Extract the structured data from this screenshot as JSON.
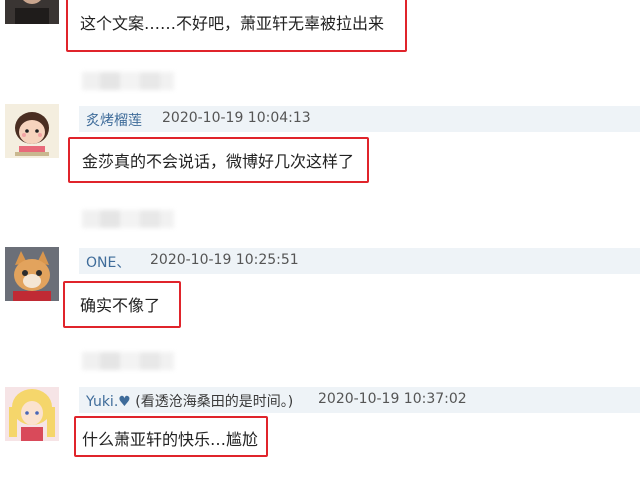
{
  "comments": [
    {
      "avatar": "user-avatar",
      "text": "这个文案……不好吧，萧亚轩无辜被拉出来"
    },
    {
      "avatar": "cartoon-girl-avatar",
      "username": "炙烤榴莲",
      "timestamp": "2020-10-19 10:04:13",
      "text": "金莎真的不会说话，微博好几次这样了"
    },
    {
      "avatar": "cat-avatar",
      "username": "ONE、",
      "timestamp": "2020-10-19 10:25:51",
      "text": "确实不像了"
    },
    {
      "avatar": "anime-girl-avatar",
      "username": "Yuki.♥",
      "username_note": "(看透沧海桑田的是时间。)",
      "timestamp": "2020-10-19 10:37:02",
      "text": "什么萧亚轩的快乐…尴尬"
    }
  ],
  "colors": {
    "highlight": "#e0242b",
    "username": "#3f6c9a",
    "meta_band": "#eef3f7"
  }
}
